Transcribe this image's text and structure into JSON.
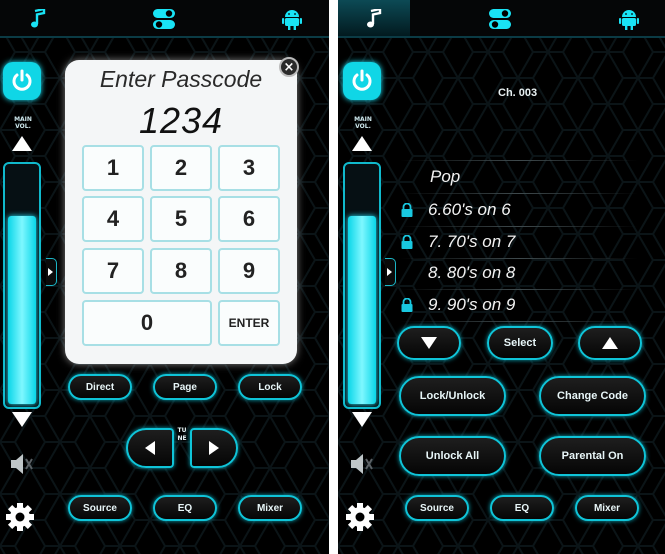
{
  "left_panel": {
    "tabs": [
      {
        "icon": "music-note-icon"
      },
      {
        "icon": "toggle-switches-icon"
      },
      {
        "icon": "android-robot-icon"
      }
    ],
    "sidebar": {
      "volume_label_line1": "MAIN",
      "volume_label_line2": "VOL.",
      "volume_level": 0.8
    },
    "passcode_dialog": {
      "title": "Enter Passcode",
      "code": "1234",
      "keys": [
        "1",
        "2",
        "3",
        "4",
        "5",
        "6",
        "7",
        "8",
        "9",
        "0"
      ],
      "enter_label": "ENTER"
    },
    "buttons": {
      "direct": "Direct",
      "page": "Page",
      "lock": "Lock",
      "tune": "TUNE",
      "source": "Source",
      "eq": "EQ",
      "mixer": "Mixer"
    }
  },
  "right_panel": {
    "channel": "Ch. 003",
    "category": "Pop",
    "channels": [
      {
        "label": "6.60's on 6",
        "locked": true
      },
      {
        "label": "7. 70's on 7",
        "locked": true
      },
      {
        "label": "8. 80's on 8",
        "locked": false
      },
      {
        "label": "9. 90's on 9",
        "locked": true
      }
    ],
    "buttons": {
      "select": "Select",
      "lock_unlock": "Lock/Unlock",
      "change_code": "Change Code",
      "unlock_all": "Unlock All",
      "parental_on": "Parental On",
      "source": "Source",
      "eq": "EQ",
      "mixer": "Mixer"
    }
  },
  "colors": {
    "accent": "#10d6e6",
    "background": "#000000"
  }
}
